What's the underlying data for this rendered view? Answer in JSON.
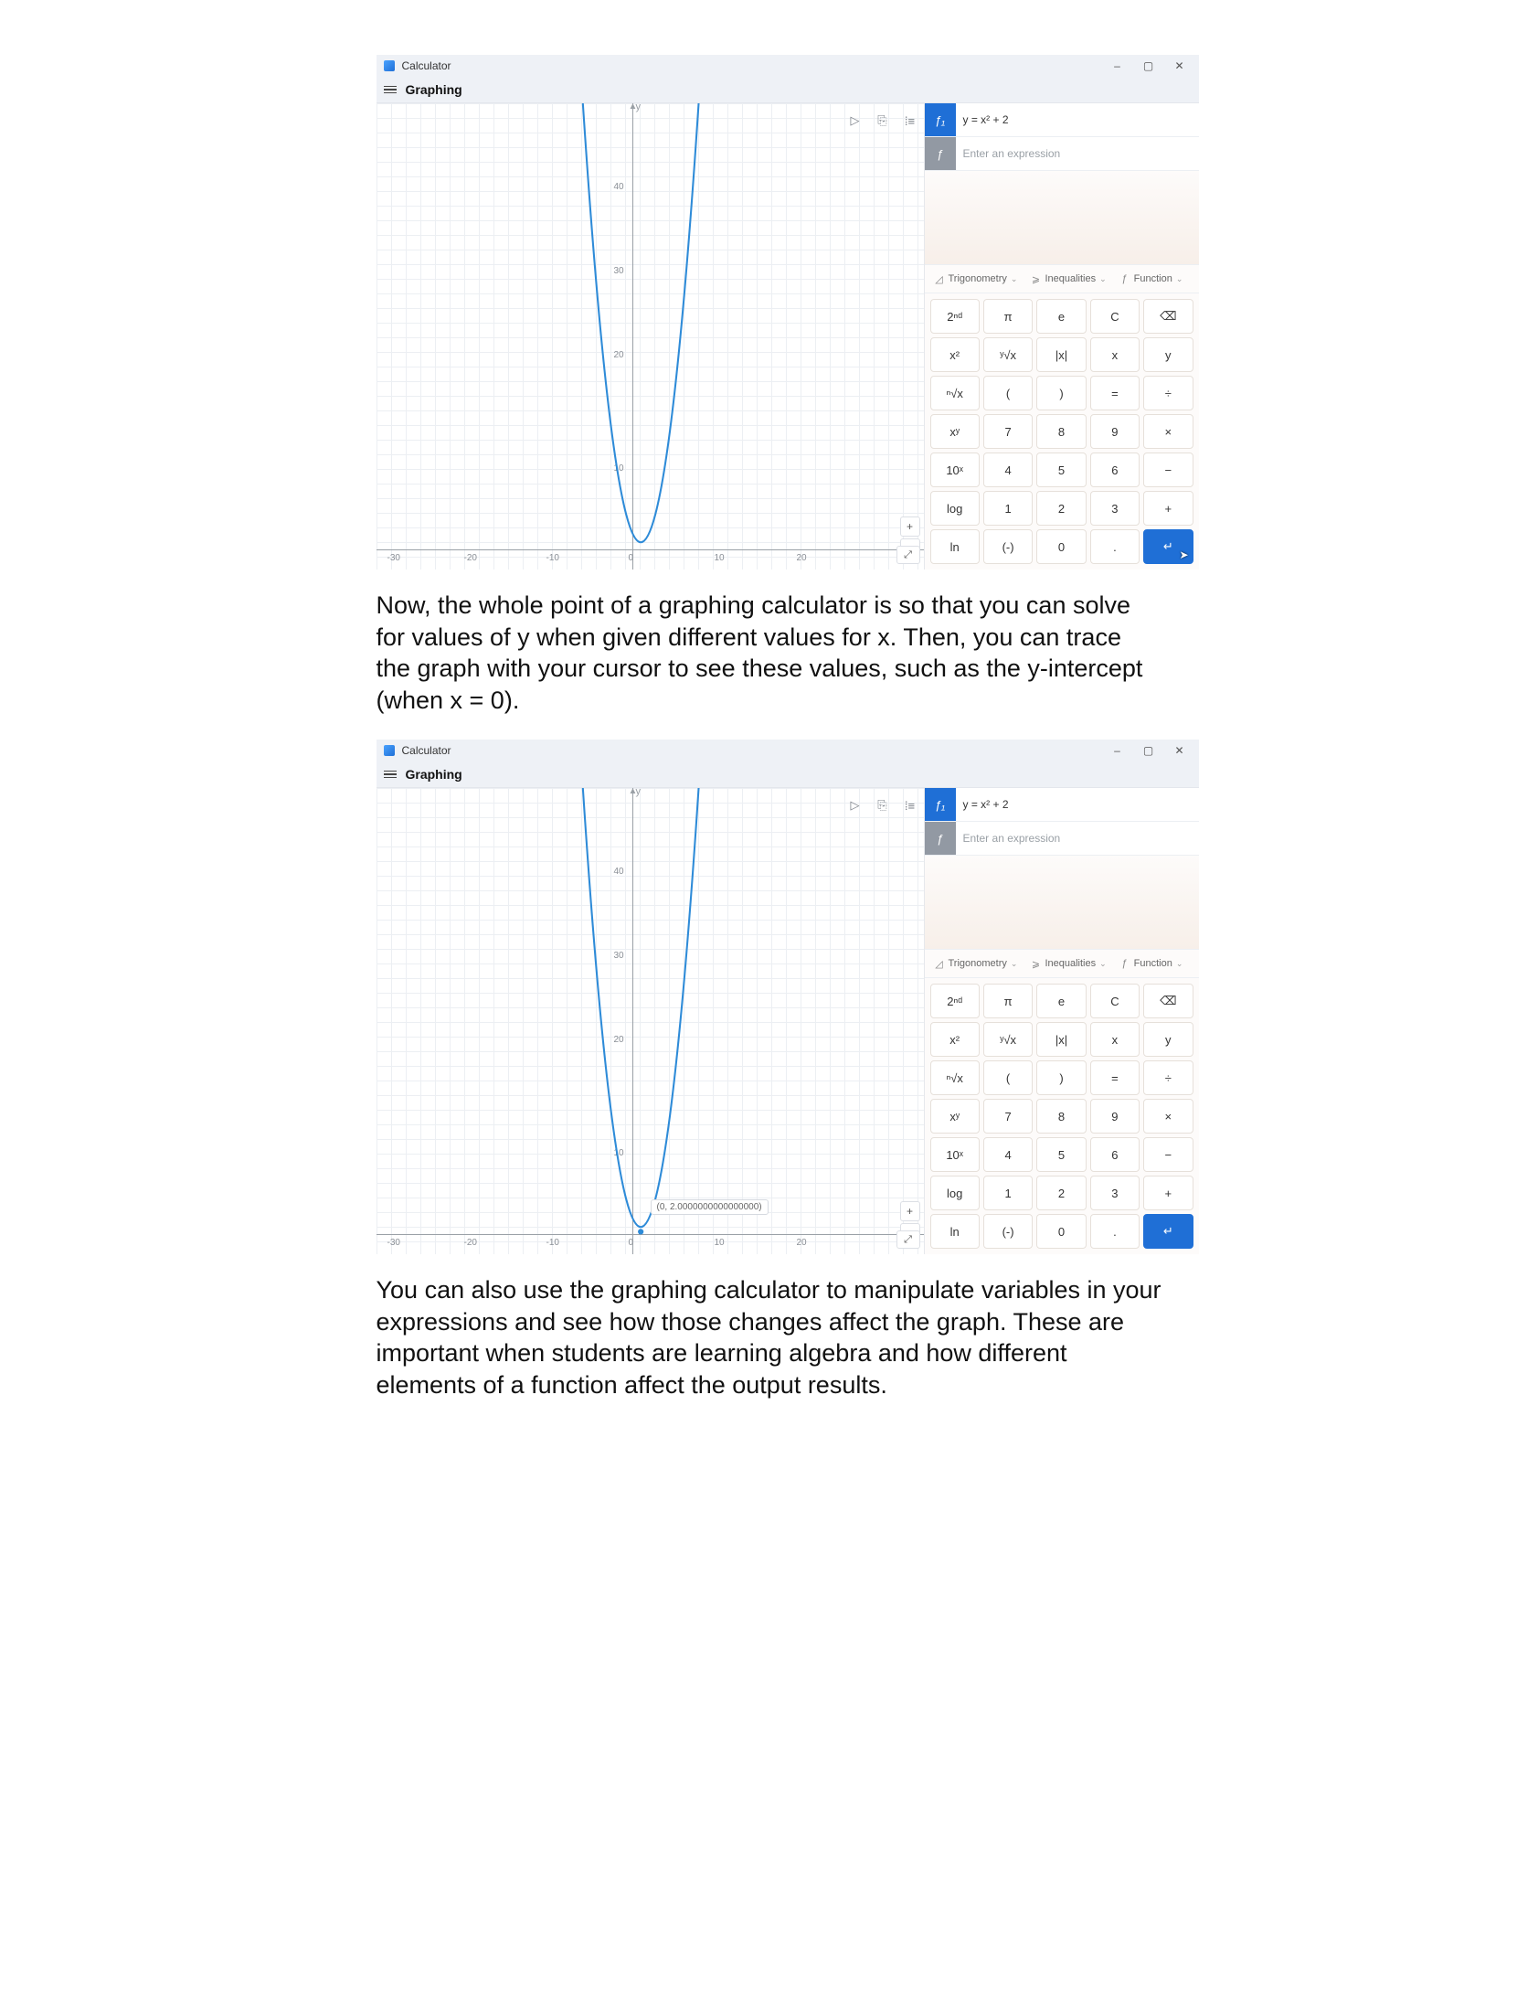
{
  "article": {
    "para1": "Now, the whole point of a graphing calculator is so that you can solve for values of y when given different values for x. Then, you can trace the graph with your cursor to see these values, such as the y-intercept (when x = 0).",
    "para2": "You can also use the graphing calculator to manipulate variables in your expressions and see how those changes affect the graph. These are important when students are learning algebra and how different elements of a function affect the output results."
  },
  "calc": {
    "app_title": "Calculator",
    "mode": "Graphing",
    "window_controls": {
      "min": "–",
      "max": "▢",
      "close": "✕"
    },
    "functions": {
      "f1_badge": "ƒ₁",
      "f1_expr": "y = x² + 2",
      "f_new_badge": "ƒ",
      "f_new_placeholder": "Enter an expression"
    },
    "graph_toolbar": {
      "play": "▷",
      "save": "⎘",
      "style": "⁞≡"
    },
    "zoom": {
      "in": "+",
      "out": "−",
      "fit": "⤢"
    },
    "axis": {
      "y_symbol": "y",
      "y_ticks": [
        "40",
        "30",
        "20",
        "10"
      ],
      "x_ticks_neg": [
        "-30",
        "-20",
        "-10",
        "0"
      ],
      "x_ticks_pos": [
        "10",
        "20"
      ]
    },
    "trace_tooltip": "(0, 2.0000000000000000)",
    "categories": {
      "trig": "Trigonometry",
      "ineq": "Inequalities",
      "func": "Function"
    },
    "keys": [
      "2ⁿᵈ",
      "π",
      "e",
      "C",
      "⌫",
      "x²",
      "ʸ√x",
      "|x|",
      "x",
      "y",
      "ⁿ√x",
      "(",
      ")",
      "=",
      "÷",
      "xʸ",
      "7",
      "8",
      "9",
      "×",
      "10ˣ",
      "4",
      "5",
      "6",
      "−",
      "log",
      "1",
      "2",
      "3",
      "+",
      "ln",
      "(-)",
      "0",
      ".",
      "↵"
    ]
  },
  "chart_data": {
    "type": "line",
    "title": "",
    "xlabel": "",
    "ylabel": "y",
    "xlim": [
      -35,
      25
    ],
    "ylim": [
      -2,
      48
    ],
    "x_ticks": [
      -30,
      -20,
      -10,
      0,
      10,
      20
    ],
    "y_ticks": [
      10,
      20,
      30,
      40
    ],
    "series": [
      {
        "name": "y = x² + 2",
        "color": "#2e8bd8",
        "x": [
          -7,
          -6,
          -5,
          -4,
          -3,
          -2,
          -1,
          0,
          1,
          2,
          3,
          4,
          5,
          6,
          7
        ],
        "y": [
          51,
          38,
          27,
          18,
          11,
          6,
          3,
          2,
          3,
          6,
          11,
          18,
          27,
          38,
          51
        ]
      }
    ],
    "annotations": [
      {
        "screenshot": 2,
        "point": [
          0,
          2
        ],
        "label": "(0, 2.0000000000000000)"
      }
    ]
  }
}
